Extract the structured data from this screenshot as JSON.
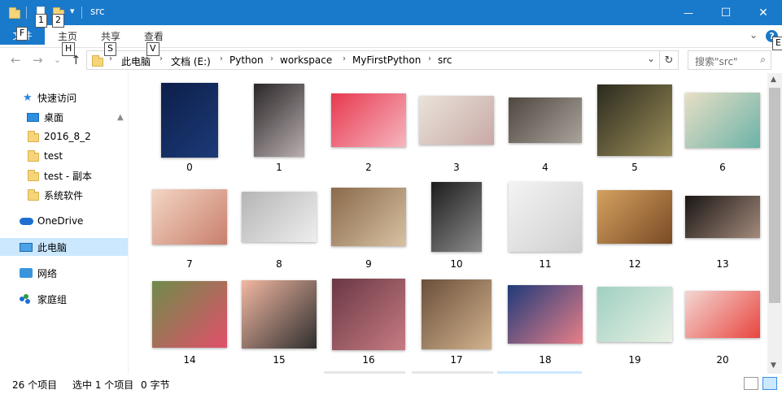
{
  "window": {
    "title": "src",
    "minimize_label": "—",
    "maximize_label": "☐",
    "close_label": "✕"
  },
  "quick_access_toolbar": {
    "keytip_1": "1",
    "keytip_2": "2",
    "dropdown_glyph": "▾"
  },
  "ribbon": {
    "file_tab": "文件",
    "file_keytip": "F",
    "tabs": [
      {
        "label": "主页",
        "keytip": "H"
      },
      {
        "label": "共享",
        "keytip": "S"
      },
      {
        "label": "查看",
        "keytip": "V"
      }
    ],
    "expand_glyph": "⌄",
    "help_label": "?",
    "help_keytip": "E"
  },
  "address": {
    "back_glyph": "←",
    "forward_glyph": "→",
    "recent_glyph": "⌄",
    "up_glyph": "↑",
    "crumbs": [
      "此电脑",
      "文档 (E:)",
      "Python",
      "workspace",
      "MyFirstPython",
      "src"
    ],
    "separator": "›",
    "dropdown_glyph": "⌄",
    "refresh_glyph": "↻"
  },
  "search": {
    "placeholder": "搜索\"src\"",
    "icon": "search-icon"
  },
  "nav_pane": {
    "quick_access": "快速访问",
    "desktop": "桌面",
    "pinned_folders": [
      "2016_8_2",
      "test",
      "test - 副本",
      "系统软件"
    ],
    "onedrive": "OneDrive",
    "this_pc": "此电脑",
    "network": "网络",
    "homegroup": "家庭组",
    "pin_glyph": "📌"
  },
  "files": [
    {
      "name": "0",
      "colors": [
        "#0d1f4a",
        "#1c3a78"
      ]
    },
    {
      "name": "1",
      "colors": [
        "#2a2627",
        "#b9aeb0"
      ]
    },
    {
      "name": "2",
      "colors": [
        "#e8384f",
        "#f6b6bf"
      ]
    },
    {
      "name": "3",
      "colors": [
        "#e9e3da",
        "#c9a9a6"
      ]
    },
    {
      "name": "4",
      "colors": [
        "#4e4841",
        "#a9a39b"
      ]
    },
    {
      "name": "5",
      "colors": [
        "#2b2a1e",
        "#9c8f5a"
      ]
    },
    {
      "name": "6",
      "colors": [
        "#e8dfc5",
        "#6bb3a8"
      ]
    },
    {
      "name": "7",
      "colors": [
        "#f3d5c4",
        "#c97f6c"
      ]
    },
    {
      "name": "8",
      "colors": [
        "#b5b5b5",
        "#eeeeee"
      ]
    },
    {
      "name": "9",
      "colors": [
        "#8a6a4a",
        "#d7c2a3"
      ]
    },
    {
      "name": "10",
      "colors": [
        "#1c1c1c",
        "#8c8c8c"
      ]
    },
    {
      "name": "11",
      "colors": [
        "#f4f4f4",
        "#cfcfcf"
      ]
    },
    {
      "name": "12",
      "colors": [
        "#d4a160",
        "#7a4a24"
      ]
    },
    {
      "name": "13",
      "colors": [
        "#1a1614",
        "#a48a7c"
      ]
    },
    {
      "name": "14",
      "colors": [
        "#6f8c4a",
        "#e24f6b"
      ]
    },
    {
      "name": "15",
      "colors": [
        "#f2b8a2",
        "#2e2e2e"
      ]
    },
    {
      "name": "16",
      "colors": [
        "#6a3844",
        "#c77b83"
      ]
    },
    {
      "name": "17",
      "colors": [
        "#6b4f3a",
        "#d2b38e"
      ]
    },
    {
      "name": "18",
      "colors": [
        "#1f3a7a",
        "#e87f88"
      ]
    },
    {
      "name": "19",
      "colors": [
        "#9fd0c2",
        "#e9f1e4"
      ]
    },
    {
      "name": "20",
      "colors": [
        "#f4d7d3",
        "#e8453e"
      ]
    }
  ],
  "status_bar": {
    "item_count": "26 个项目",
    "selection": "选中 1 个项目",
    "size": "0 字节"
  },
  "colors": {
    "accent": "#1979ca",
    "selection": "#cce8ff"
  }
}
